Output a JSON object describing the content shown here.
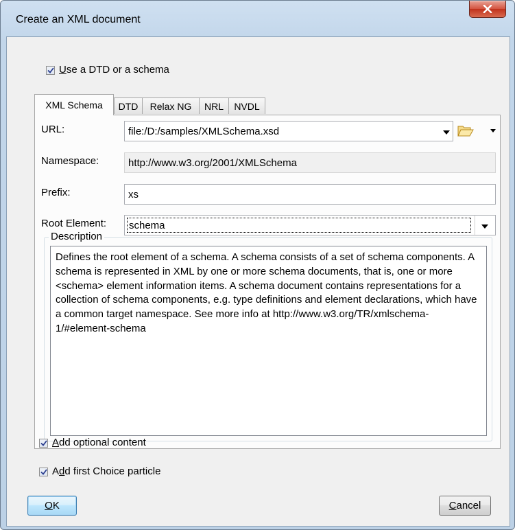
{
  "window": {
    "title": "Create an XML document"
  },
  "use_schema": {
    "checked": true,
    "label_mnemonic": "U",
    "label_rest": "se a DTD or a schema"
  },
  "tabs": [
    {
      "label": "XML Schema",
      "active": true
    },
    {
      "label": "DTD",
      "active": false
    },
    {
      "label": "Relax NG",
      "active": false
    },
    {
      "label": "NRL",
      "active": false
    },
    {
      "label": "NVDL",
      "active": false
    }
  ],
  "form": {
    "url_label": "URL:",
    "url_value": "file:/D:/samples/XMLSchema.xsd",
    "namespace_label": "Namespace:",
    "namespace_value": "http://www.w3.org/2001/XMLSchema",
    "prefix_label": "Prefix:",
    "prefix_value": "xs",
    "root_label": "Root Element:",
    "root_value": "schema"
  },
  "description": {
    "legend": "Description",
    "text": "Defines the root element of a schema. A schema consists of a set of schema components. A schema is represented in XML by one or more schema documents, that is, one or more <schema> element information items. A schema document contains representations for a collection of schema components, e.g. type definitions and element declarations, which have a common target namespace. See more info at http://www.w3.org/TR/xmlschema-1/#element-schema"
  },
  "options": {
    "optional_content": {
      "checked": true,
      "mnemonic": "A",
      "rest": "dd optional content"
    },
    "first_choice": {
      "checked": true,
      "pre": "A",
      "mnemonic": "d",
      "rest": "d first Choice particle"
    }
  },
  "buttons": {
    "ok_mnemonic": "O",
    "ok_rest": "K",
    "cancel_mnemonic": "C",
    "cancel_rest": "ancel"
  },
  "colors": {
    "close_button": "#c9472f",
    "checkmark": "#2a3d8f",
    "default_button_border": "#3c7fb1"
  }
}
